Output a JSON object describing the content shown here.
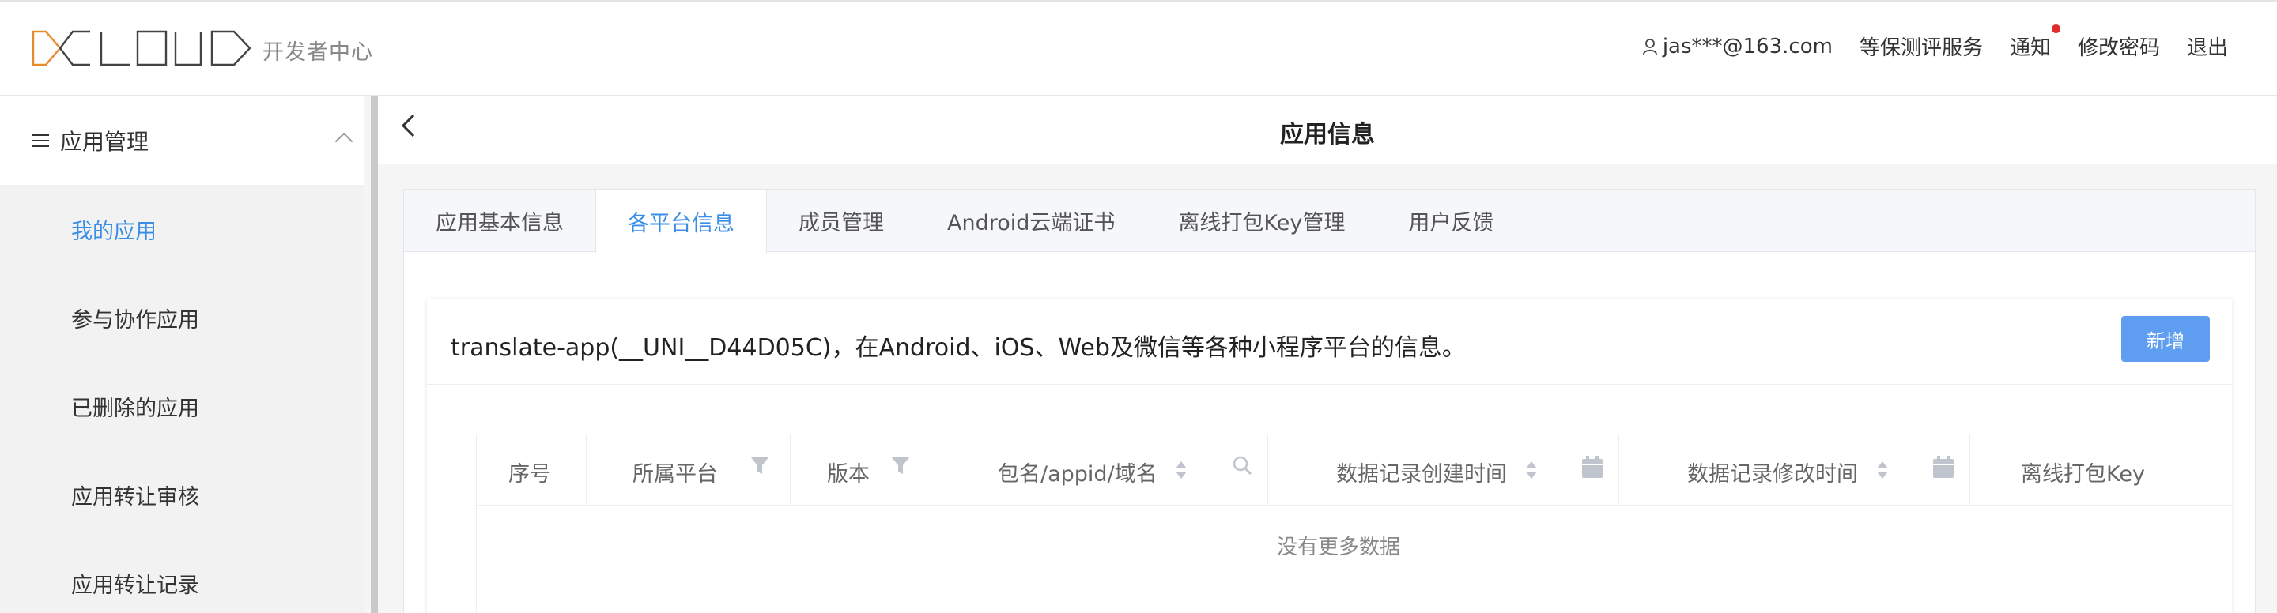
{
  "header": {
    "logo_text": "DCLOUD",
    "subtitle": "开发者中心",
    "user": "jas***@163.com",
    "nav": [
      "等保测评服务",
      "通知",
      "修改密码",
      "退出"
    ]
  },
  "sidebar": {
    "section": "应用管理",
    "items": [
      {
        "label": "我的应用",
        "active": true
      },
      {
        "label": "参与协作应用",
        "active": false
      },
      {
        "label": "已删除的应用",
        "active": false
      },
      {
        "label": "应用转让审核",
        "active": false
      },
      {
        "label": "应用转让记录",
        "active": false
      }
    ]
  },
  "page": {
    "title": "应用信息",
    "tabs": [
      {
        "label": "应用基本信息",
        "active": false
      },
      {
        "label": "各平台信息",
        "active": true
      },
      {
        "label": "成员管理",
        "active": false
      },
      {
        "label": "Android云端证书",
        "active": false
      },
      {
        "label": "离线打包Key管理",
        "active": false
      },
      {
        "label": "用户反馈",
        "active": false
      }
    ],
    "card_title": "translate-app(__UNI__D44D05C)，在Android、iOS、Web及微信等各种小程序平台的信息。",
    "add_button": "新增",
    "table": {
      "columns": [
        "序号",
        "所属平台",
        "版本",
        "包名/appid/域名",
        "数据记录创建时间",
        "数据记录修改时间",
        "离线打包Key"
      ],
      "empty_text": "没有更多数据"
    }
  },
  "colors": {
    "accent": "#3a8ee6",
    "button": "#5f9df0",
    "logo": "#e88a2e",
    "notify_dot": "#e02c2c"
  }
}
